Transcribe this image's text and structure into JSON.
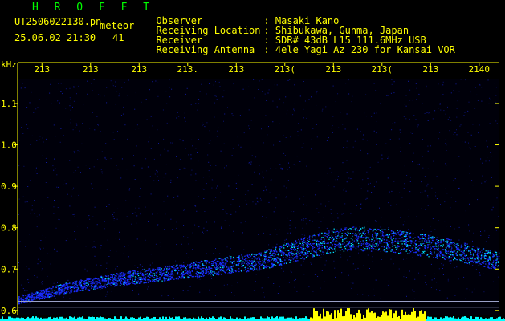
{
  "header": {
    "brand": "H R O F F T",
    "filename": "UT2506022130.pn",
    "mode": "meteor",
    "datetime": "25.06.02 21:30",
    "count": "41",
    "info": [
      {
        "key": "Observer",
        "value": ": Masaki Kano"
      },
      {
        "key": "Receiving Location",
        "value": ": Shibukawa, Gunma, Japan"
      },
      {
        "key": "Receiver",
        "value": ": SDR# 43dB L15 111.6MHz USB"
      },
      {
        "key": "Receiving Antenna",
        "value": ": 4ele Yagi Az 230 for Kansai VOR"
      }
    ]
  },
  "colors": {
    "background": "#000000",
    "text": "#ffff00",
    "brand": "#00ff00",
    "grid_line": "#ffffff",
    "echo_low": "#1a2cff",
    "echo_high": "#00e0ff",
    "baseline": "#00ffff",
    "baseline_peak": "#ffff00"
  },
  "chart_data": {
    "type": "heatmap",
    "title": "",
    "ylabel": "kHz",
    "xlabel": "",
    "y_ticks": [
      "1.1",
      "1.0",
      "0.9",
      "0.8",
      "0.7",
      "0.6"
    ],
    "y_tick_values": [
      1.1,
      1.0,
      0.9,
      0.8,
      0.7,
      0.6
    ],
    "ylim": [
      0.59,
      1.16
    ],
    "x_ticks": [
      "213",
      "213",
      "213",
      "213.",
      "213",
      "213(",
      "213",
      "213(",
      "213",
      "2140"
    ],
    "x_tick_minutes": [
      2131,
      2132,
      2133,
      2134,
      2135,
      2136,
      2137,
      2138,
      2139,
      2140
    ],
    "xlim": [
      2130.5,
      2140.4
    ],
    "echo_trace": {
      "name": "",
      "x": [
        2130.5,
        2131.5,
        2132.5,
        2133.5,
        2134.5,
        2135.5,
        2136.5,
        2137.0,
        2137.5,
        2138.0,
        2138.5,
        2139.0,
        2139.5,
        2140.0,
        2140.4
      ],
      "y": [
        0.625,
        0.655,
        0.675,
        0.69,
        0.705,
        0.72,
        0.755,
        0.77,
        0.775,
        0.77,
        0.765,
        0.755,
        0.745,
        0.73,
        0.72
      ]
    },
    "reference_lines_khz": [
      0.622,
      0.608
    ],
    "grid": false
  }
}
